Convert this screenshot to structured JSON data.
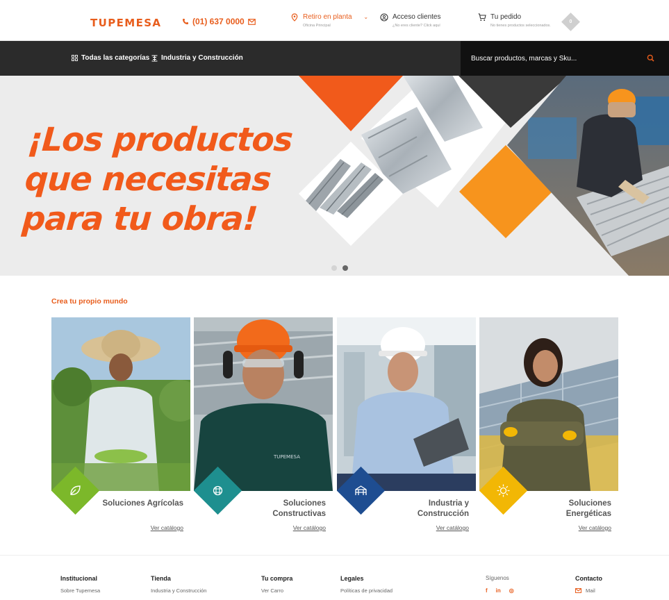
{
  "header": {
    "logo": "TUPEMESA",
    "phone": "(01) 637 0000",
    "pickup": {
      "label": "Retiro en planta",
      "sub": "Oficina Principal"
    },
    "account": {
      "label": "Acceso clientes",
      "sub": "¿No eres cliente? Click aquí"
    },
    "cart": {
      "label": "Tu pedido",
      "sub": "No tienes productos seleccionados.",
      "count": "0"
    }
  },
  "nav": {
    "categories": "Todas las categorías",
    "industry": "Industria y Construcción",
    "search_placeholder": "Buscar productos, marcas y Sku..."
  },
  "hero": {
    "lines": [
      "¡Los productos",
      "que necesitas",
      "para tu obra!"
    ],
    "slides": 2,
    "active_slide": 2
  },
  "section": {
    "title": "Crea tu propio mundo",
    "cards": [
      {
        "title": "Soluciones Agrícolas",
        "link": "Ver catálogo",
        "color": "#7cb82a",
        "icon": "leaf-icon"
      },
      {
        "title": "Soluciones Constructivas",
        "link": "Ver catálogo",
        "color": "#1e8f8f",
        "icon": "grid-icon"
      },
      {
        "title": "Industria y Construcción",
        "link": "Ver catálogo",
        "color": "#1e4d91",
        "icon": "structure-icon"
      },
      {
        "title": "Soluciones Energéticas",
        "link": "Ver catálogo",
        "color": "#f2b705",
        "icon": "sun-icon"
      }
    ]
  },
  "footer": {
    "institucional": {
      "h": "Institucional",
      "l": "Sobre Tupemesa"
    },
    "tienda": {
      "h": "Tienda",
      "l": "Industria y Construcción"
    },
    "compra": {
      "h": "Tu compra",
      "l": "Ver Carro"
    },
    "legales": {
      "h": "Legales",
      "l": "Políticas de privacidad"
    },
    "siguenos": {
      "h": "Síguenos",
      "social": [
        "f",
        "in",
        "◎"
      ]
    },
    "contacto": {
      "h": "Contacto",
      "l": "Mail"
    }
  },
  "colors": {
    "brand": "#e85d1c",
    "dark": "#2b2b2b"
  }
}
